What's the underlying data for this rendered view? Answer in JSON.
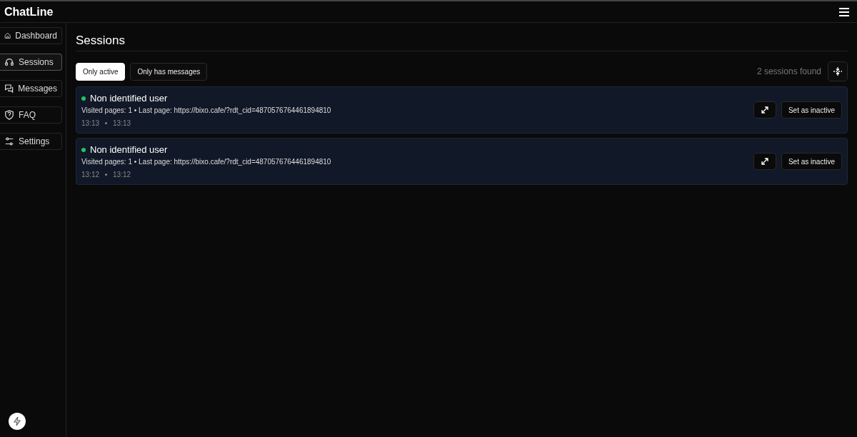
{
  "app": {
    "title": "ChatLine"
  },
  "sidebar": {
    "items": [
      {
        "label": "Dashboard",
        "kind": "home",
        "selected": false
      },
      {
        "label": "Sessions",
        "kind": "headset",
        "selected": true
      },
      {
        "label": "Messages",
        "kind": "chat",
        "selected": false
      },
      {
        "label": "FAQ",
        "kind": "shield",
        "selected": false
      },
      {
        "label": "Settings",
        "kind": "sliders",
        "selected": false
      }
    ]
  },
  "page": {
    "title": "Sessions"
  },
  "filters": [
    {
      "label": "Only active",
      "selected": true
    },
    {
      "label": "Only has messages",
      "selected": false
    }
  ],
  "count": "2 sessions found",
  "sessions": [
    {
      "name": "Non identified user",
      "color": "#22c55e",
      "details": "Visited pages: 1 • Last page: https://bixo.cafe/?rdt_cid=4870576764461894810",
      "start": "13:13",
      "end": "13:13",
      "action": "Set as inactive"
    },
    {
      "name": "Non identified user",
      "color": "#22c55e",
      "details": "Visited pages: 1 • Last page: https://bixo.cafe/?rdt_cid=4870576764461894810",
      "start": "13:12",
      "end": "13:12",
      "action": "Set as inactive"
    }
  ]
}
